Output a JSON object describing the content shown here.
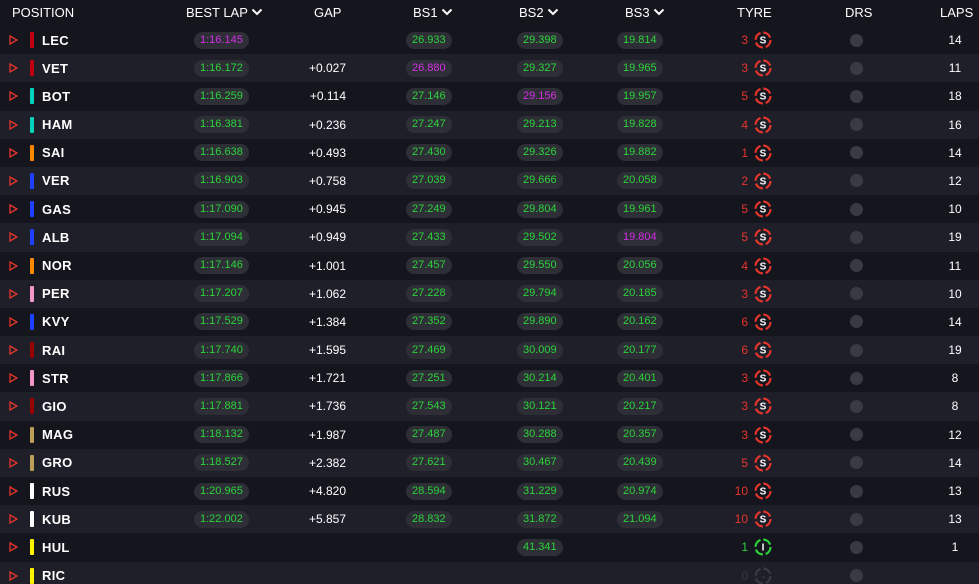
{
  "header": {
    "position": "POSITION",
    "best_lap": "BEST LAP",
    "gap": "GAP",
    "bs1": "BS1",
    "bs2": "BS2",
    "bs3": "BS3",
    "tyre": "TYRE",
    "drs": "DRS",
    "laps": "LAPS"
  },
  "colors": {
    "background": "#15151e",
    "row_alt": "#1f1f2a",
    "pill": "#2e2f36",
    "personal_best": "#2bd33b",
    "overall_best": "#d42fe6",
    "soft_tyre": "#e8352c",
    "inter_tyre": "#2bd33b"
  },
  "rows": [
    {
      "code": "LEC",
      "team_color": "#c00010",
      "best_lap": "1:16.145",
      "best_lap_color": "purple",
      "gap": "",
      "bs1": "26.933",
      "bs1_color": "green",
      "bs2": "29.398",
      "bs2_color": "green",
      "bs3": "19.814",
      "bs3_color": "green",
      "tyre_age": "3",
      "tyre": "S",
      "drs": "off",
      "laps": "14"
    },
    {
      "code": "VET",
      "team_color": "#c00010",
      "best_lap": "1:16.172",
      "best_lap_color": "green",
      "gap": "+0.027",
      "bs1": "26.880",
      "bs1_color": "purple",
      "bs2": "29.327",
      "bs2_color": "green",
      "bs3": "19.965",
      "bs3_color": "green",
      "tyre_age": "3",
      "tyre": "S",
      "drs": "off",
      "laps": "11"
    },
    {
      "code": "BOT",
      "team_color": "#00d2be",
      "best_lap": "1:16.259",
      "best_lap_color": "green",
      "gap": "+0.114",
      "bs1": "27.146",
      "bs1_color": "green",
      "bs2": "29.156",
      "bs2_color": "purple",
      "bs3": "19.957",
      "bs3_color": "green",
      "tyre_age": "5",
      "tyre": "S",
      "drs": "off",
      "laps": "18"
    },
    {
      "code": "HAM",
      "team_color": "#00d2be",
      "best_lap": "1:16.381",
      "best_lap_color": "green",
      "gap": "+0.236",
      "bs1": "27.247",
      "bs1_color": "green",
      "bs2": "29.213",
      "bs2_color": "green",
      "bs3": "19.828",
      "bs3_color": "green",
      "tyre_age": "4",
      "tyre": "S",
      "drs": "off",
      "laps": "16"
    },
    {
      "code": "SAI",
      "team_color": "#ff8700",
      "best_lap": "1:16.638",
      "best_lap_color": "green",
      "gap": "+0.493",
      "bs1": "27.430",
      "bs1_color": "green",
      "bs2": "29.326",
      "bs2_color": "green",
      "bs3": "19.882",
      "bs3_color": "green",
      "tyre_age": "1",
      "tyre": "S",
      "drs": "off",
      "laps": "14"
    },
    {
      "code": "VER",
      "team_color": "#1e41ff",
      "best_lap": "1:16.903",
      "best_lap_color": "green",
      "gap": "+0.758",
      "bs1": "27.039",
      "bs1_color": "green",
      "bs2": "29.666",
      "bs2_color": "green",
      "bs3": "20.058",
      "bs3_color": "green",
      "tyre_age": "2",
      "tyre": "S",
      "drs": "off",
      "laps": "12"
    },
    {
      "code": "GAS",
      "team_color": "#1e41ff",
      "best_lap": "1:17.090",
      "best_lap_color": "green",
      "gap": "+0.945",
      "bs1": "27.249",
      "bs1_color": "green",
      "bs2": "29.804",
      "bs2_color": "green",
      "bs3": "19.961",
      "bs3_color": "green",
      "tyre_age": "5",
      "tyre": "S",
      "drs": "off",
      "laps": "10"
    },
    {
      "code": "ALB",
      "team_color": "#1e41ff",
      "best_lap": "1:17.094",
      "best_lap_color": "green",
      "gap": "+0.949",
      "bs1": "27.433",
      "bs1_color": "green",
      "bs2": "29.502",
      "bs2_color": "green",
      "bs3": "19.804",
      "bs3_color": "purple",
      "tyre_age": "5",
      "tyre": "S",
      "drs": "off",
      "laps": "19"
    },
    {
      "code": "NOR",
      "team_color": "#ff8700",
      "best_lap": "1:17.146",
      "best_lap_color": "green",
      "gap": "+1.001",
      "bs1": "27.457",
      "bs1_color": "green",
      "bs2": "29.550",
      "bs2_color": "green",
      "bs3": "20.056",
      "bs3_color": "green",
      "tyre_age": "4",
      "tyre": "S",
      "drs": "off",
      "laps": "11"
    },
    {
      "code": "PER",
      "team_color": "#f596c8",
      "best_lap": "1:17.207",
      "best_lap_color": "green",
      "gap": "+1.062",
      "bs1": "27.228",
      "bs1_color": "green",
      "bs2": "29.794",
      "bs2_color": "green",
      "bs3": "20.185",
      "bs3_color": "green",
      "tyre_age": "3",
      "tyre": "S",
      "drs": "off",
      "laps": "10"
    },
    {
      "code": "KVY",
      "team_color": "#1e41ff",
      "best_lap": "1:17.529",
      "best_lap_color": "green",
      "gap": "+1.384",
      "bs1": "27.352",
      "bs1_color": "green",
      "bs2": "29.890",
      "bs2_color": "green",
      "bs3": "20.162",
      "bs3_color": "green",
      "tyre_age": "6",
      "tyre": "S",
      "drs": "off",
      "laps": "14"
    },
    {
      "code": "RAI",
      "team_color": "#9b0000",
      "best_lap": "1:17.740",
      "best_lap_color": "green",
      "gap": "+1.595",
      "bs1": "27.469",
      "bs1_color": "green",
      "bs2": "30.009",
      "bs2_color": "green",
      "bs3": "20.177",
      "bs3_color": "green",
      "tyre_age": "6",
      "tyre": "S",
      "drs": "off",
      "laps": "19"
    },
    {
      "code": "STR",
      "team_color": "#f596c8",
      "best_lap": "1:17.866",
      "best_lap_color": "green",
      "gap": "+1.721",
      "bs1": "27.251",
      "bs1_color": "green",
      "bs2": "30.214",
      "bs2_color": "green",
      "bs3": "20.401",
      "bs3_color": "green",
      "tyre_age": "3",
      "tyre": "S",
      "drs": "off",
      "laps": "8"
    },
    {
      "code": "GIO",
      "team_color": "#9b0000",
      "best_lap": "1:17.881",
      "best_lap_color": "green",
      "gap": "+1.736",
      "bs1": "27.543",
      "bs1_color": "green",
      "bs2": "30.121",
      "bs2_color": "green",
      "bs3": "20.217",
      "bs3_color": "green",
      "tyre_age": "3",
      "tyre": "S",
      "drs": "off",
      "laps": "8"
    },
    {
      "code": "MAG",
      "team_color": "#bd9e57",
      "best_lap": "1:18.132",
      "best_lap_color": "green",
      "gap": "+1.987",
      "bs1": "27.487",
      "bs1_color": "green",
      "bs2": "30.288",
      "bs2_color": "green",
      "bs3": "20.357",
      "bs3_color": "green",
      "tyre_age": "3",
      "tyre": "S",
      "drs": "off",
      "laps": "12"
    },
    {
      "code": "GRO",
      "team_color": "#bd9e57",
      "best_lap": "1:18.527",
      "best_lap_color": "green",
      "gap": "+2.382",
      "bs1": "27.621",
      "bs1_color": "green",
      "bs2": "30.467",
      "bs2_color": "green",
      "bs3": "20.439",
      "bs3_color": "green",
      "tyre_age": "5",
      "tyre": "S",
      "drs": "off",
      "laps": "14"
    },
    {
      "code": "RUS",
      "team_color": "#ffffff",
      "best_lap": "1:20.965",
      "best_lap_color": "green",
      "gap": "+4.820",
      "bs1": "28.594",
      "bs1_color": "green",
      "bs2": "31.229",
      "bs2_color": "green",
      "bs3": "20.974",
      "bs3_color": "green",
      "tyre_age": "10",
      "tyre": "S",
      "drs": "off",
      "laps": "13"
    },
    {
      "code": "KUB",
      "team_color": "#ffffff",
      "best_lap": "1:22.002",
      "best_lap_color": "green",
      "gap": "+5.857",
      "bs1": "28.832",
      "bs1_color": "green",
      "bs2": "31.872",
      "bs2_color": "green",
      "bs3": "21.094",
      "bs3_color": "green",
      "tyre_age": "10",
      "tyre": "S",
      "drs": "off",
      "laps": "13"
    },
    {
      "code": "HUL",
      "team_color": "#fff500",
      "best_lap": "",
      "best_lap_color": "green",
      "gap": "",
      "bs1": "",
      "bs1_color": "green",
      "bs2": "41.341",
      "bs2_color": "green",
      "bs3": "",
      "bs3_color": "green",
      "tyre_age": "1",
      "tyre": "I",
      "drs": "off",
      "laps": "1"
    },
    {
      "code": "RIC",
      "team_color": "#fff500",
      "best_lap": "",
      "best_lap_color": "green",
      "gap": "",
      "bs1": "",
      "bs1_color": "green",
      "bs2": "",
      "bs2_color": "green",
      "bs3": "",
      "bs3_color": "green",
      "tyre_age": "0",
      "tyre": "-",
      "drs": "off",
      "laps": ""
    }
  ]
}
